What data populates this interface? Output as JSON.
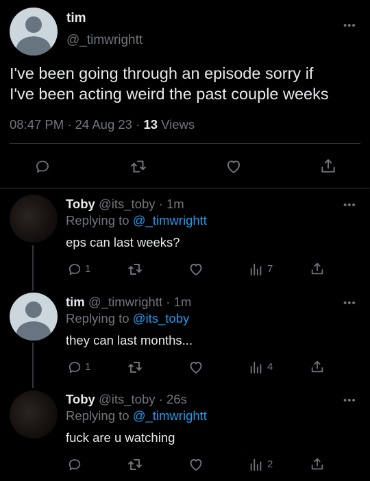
{
  "main_tweet": {
    "name": "tim",
    "handle": "@_timwrightt",
    "text_line1": "I've been going through an episode sorry if",
    "text_line2": "I've been acting weird the past couple weeks",
    "time": "08:47 PM",
    "date": "24 Aug 23",
    "views_count": "13",
    "views_label": "Views"
  },
  "replies": [
    {
      "name": "Toby",
      "handle": "@its_toby",
      "time": "1m",
      "replying_prefix": "Replying to",
      "replying_to": "@_timwrightt",
      "text": "eps can last weeks?",
      "reply_count": "1",
      "views": "7",
      "avatar": "photo"
    },
    {
      "name": "tim",
      "handle": "@_timwrightt",
      "time": "1m",
      "replying_prefix": "Replying to",
      "replying_to": "@its_toby",
      "text": "they can last months...",
      "reply_count": "1",
      "views": "4",
      "avatar": "default"
    },
    {
      "name": "Toby",
      "handle": "@its_toby",
      "time": "26s",
      "replying_prefix": "Replying to",
      "replying_to": "@_timwrightt",
      "text": "fuck are u watching",
      "reply_count": "",
      "views": "2",
      "avatar": "photo"
    }
  ],
  "separator": "·",
  "more_glyph": "•••",
  "colors": {
    "background": "#000000",
    "text": "#e7e9ea",
    "muted": "#71767b",
    "link": "#1d9bf0",
    "divider": "#2f3336"
  },
  "icons": [
    "more-icon",
    "reply-icon",
    "retweet-icon",
    "like-icon",
    "share-icon",
    "views-icon"
  ]
}
